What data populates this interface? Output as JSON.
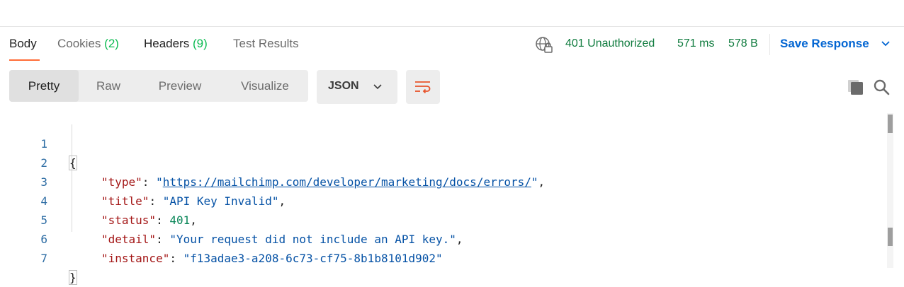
{
  "response_tabs": [
    {
      "label": "Body",
      "count": ""
    },
    {
      "label": "Cookies",
      "count": "(2)"
    },
    {
      "label": "Headers",
      "count": "(9)"
    },
    {
      "label": "Test Results",
      "count": ""
    }
  ],
  "status": {
    "code_text": "401 Unauthorized",
    "time": "571 ms",
    "size": "578 B"
  },
  "save_response": {
    "label": "Save Response"
  },
  "view_modes": [
    "Pretty",
    "Raw",
    "Preview",
    "Visualize"
  ],
  "format_dropdown": {
    "selected": "JSON"
  },
  "code_lines": {
    "n1": "1",
    "n2": "2",
    "n3": "3",
    "n4": "4",
    "n5": "5",
    "n6": "6",
    "n7": "7",
    "open_brace": "{",
    "close_brace": "}",
    "k_type": "\"type\"",
    "v_type": "https://mailchimp.com/developer/marketing/docs/errors/",
    "k_title": "\"title\"",
    "v_title": "\"API Key Invalid\"",
    "k_status": "\"status\"",
    "v_status": "401",
    "k_detail": "\"detail\"",
    "v_detail": "\"Your request did not include an API key.\"",
    "k_instance": "\"instance\"",
    "v_instance": "\"f13adae3-a208-6c73-cf75-8b1b8101d902\""
  },
  "colors": {
    "accent_orange": "#ff6c37",
    "status_green": "#0f7b3e",
    "link_blue": "#0265d2"
  },
  "icons": [
    "globe-lock-icon",
    "chevron-down-icon",
    "wrap-lines-icon",
    "copy-icon",
    "search-icon"
  ]
}
